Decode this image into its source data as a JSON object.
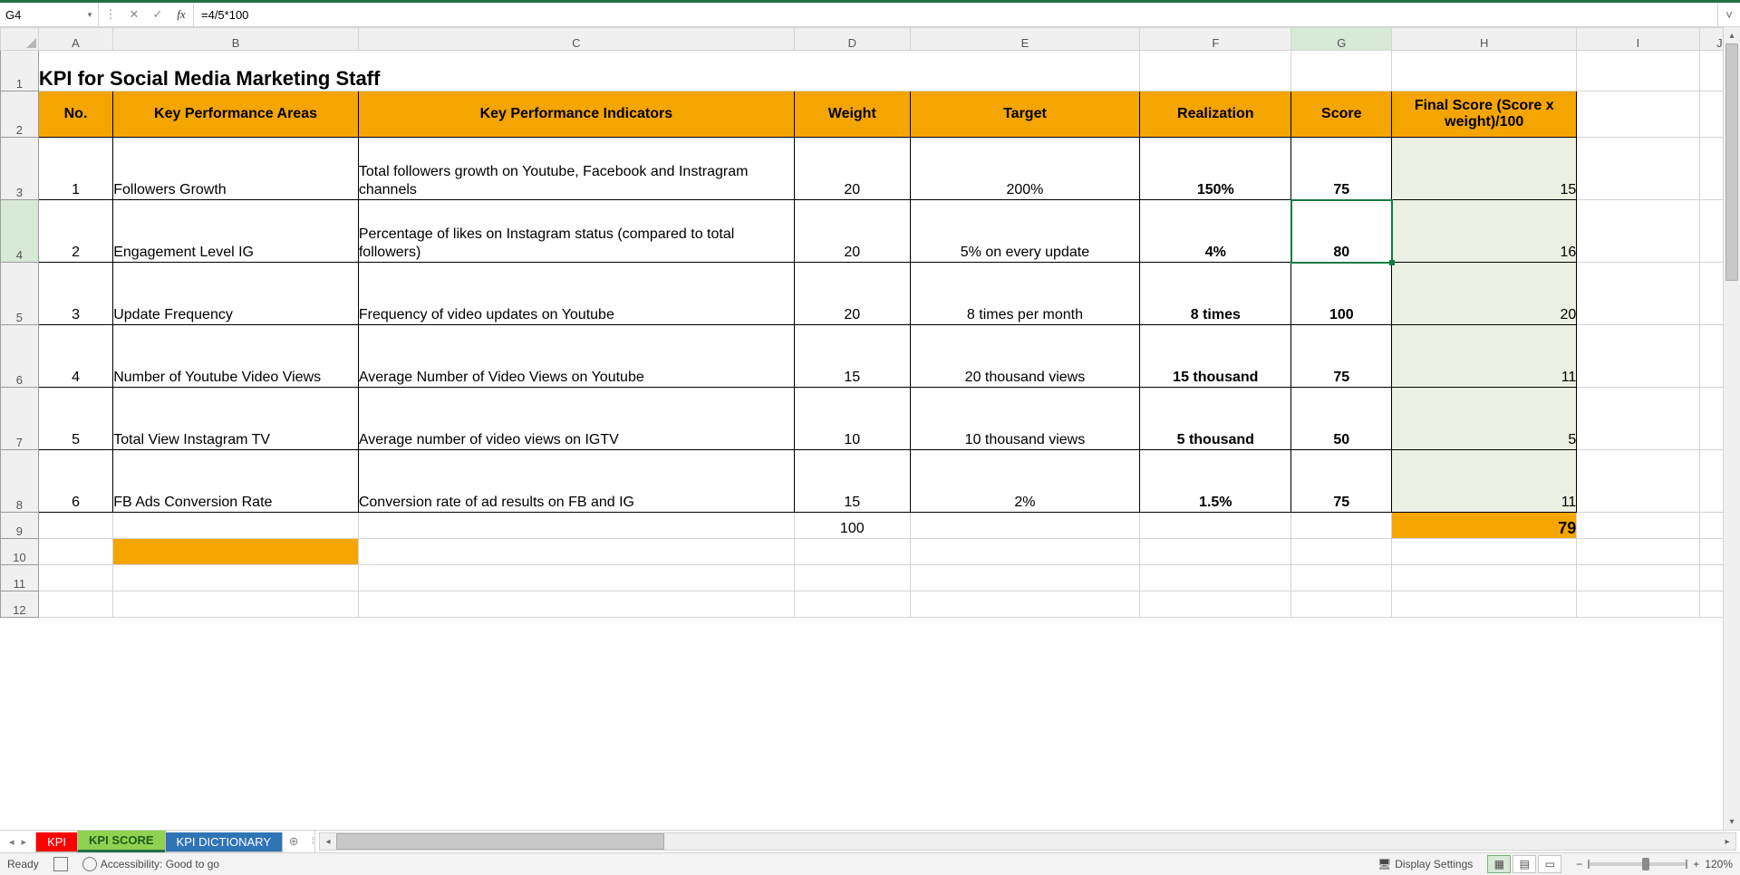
{
  "formula_bar": {
    "cell_ref": "G4",
    "cancel_glyph": "✕",
    "confirm_glyph": "✓",
    "fx_label": "fx",
    "formula": "=4/5*100",
    "dropdown_glyph": "▾",
    "expand_glyph": "˅"
  },
  "columns": [
    "A",
    "B",
    "C",
    "D",
    "E",
    "F",
    "G",
    "H",
    "I",
    "J"
  ],
  "row_numbers": [
    "1",
    "2",
    "3",
    "4",
    "5",
    "6",
    "7",
    "8",
    "9",
    "10",
    "11",
    "12"
  ],
  "title": "KPI for Social Media Marketing Staff",
  "headers": {
    "no": "No.",
    "area": "Key Performance Areas",
    "indicator": "Key Performance Indicators",
    "weight": "Weight",
    "target": "Target",
    "realization": "Realization",
    "score": "Score",
    "final": "Final Score (Score x weight)/100"
  },
  "rows": [
    {
      "no": "1",
      "area": "Followers Growth",
      "indicator": "Total followers growth on Youtube, Facebook and Instragram channels",
      "weight": "20",
      "target": "200%",
      "realization": "150%",
      "score": "75",
      "final": "15"
    },
    {
      "no": "2",
      "area": "Engagement Level IG",
      "indicator": "Percentage of likes on Instagram status (compared to total followers)",
      "weight": "20",
      "target": "5% on every update",
      "realization": "4%",
      "score": "80",
      "final": "16"
    },
    {
      "no": "3",
      "area": "Update Frequency",
      "indicator": "Frequency of video updates on Youtube",
      "weight": "20",
      "target": "8 times per month",
      "realization": "8 times",
      "score": "100",
      "final": "20"
    },
    {
      "no": "4",
      "area": "Number of Youtube Video Views",
      "indicator": "Average Number of Video Views on Youtube",
      "weight": "15",
      "target": "20 thousand views",
      "realization": "15 thousand",
      "score": "75",
      "final": "11"
    },
    {
      "no": "5",
      "area": "Total View Instagram TV",
      "indicator": "Average number of video views on IGTV",
      "weight": "10",
      "target": "10 thousand views",
      "realization": "5 thousand",
      "score": "50",
      "final": "5"
    },
    {
      "no": "6",
      "area": "FB Ads Conversion Rate",
      "indicator": "Conversion rate of ad results on FB and IG",
      "weight": "15",
      "target": "2%",
      "realization": "1.5%",
      "score": "75",
      "final": "11"
    }
  ],
  "totals": {
    "weight": "100",
    "final": "79"
  },
  "tabs": {
    "nav_prev": "◂",
    "nav_next": "▸",
    "items": [
      {
        "label": "KPI",
        "cls": "red"
      },
      {
        "label": "KPI SCORE",
        "cls": "green"
      },
      {
        "label": "KPI DICTIONARY",
        "cls": "blue"
      }
    ],
    "new_tab_glyph": "⊕"
  },
  "hscroll": {
    "left": "◂",
    "right": "▸",
    "sep": "⁞"
  },
  "vscroll": {
    "up": "▴",
    "down": "▾"
  },
  "status": {
    "ready": "Ready",
    "accessibility": "Accessibility: Good to go",
    "display_settings": "Display Settings",
    "zoom_minus": "−",
    "zoom_plus": "+",
    "zoom_value": "120%"
  },
  "active_cell": "G4"
}
